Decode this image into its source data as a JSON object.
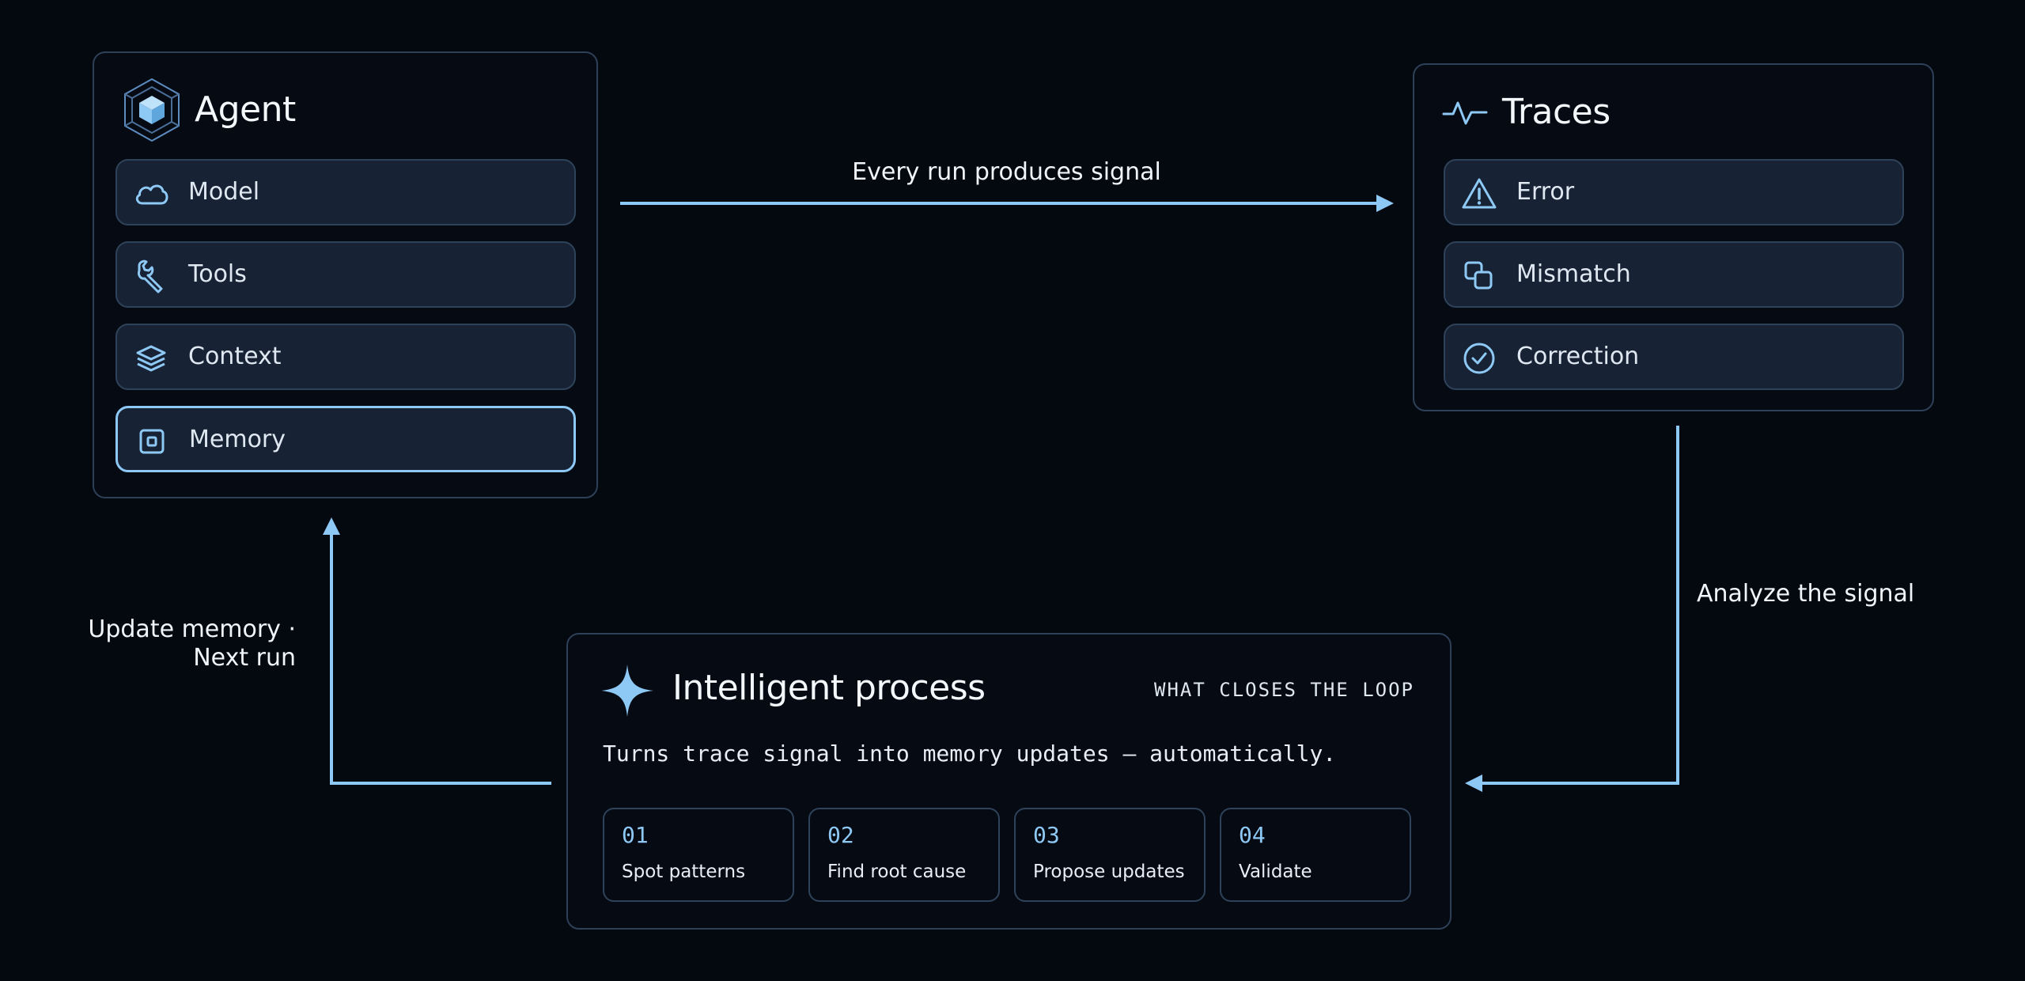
{
  "colors": {
    "background": "#04080f",
    "card_border": "#2d4058",
    "row_fill": "#172234",
    "accent": "#8ec9f5"
  },
  "agent": {
    "title": "Agent",
    "icon": "cube-icon",
    "items": [
      {
        "label": "Model",
        "icon": "cloud-icon"
      },
      {
        "label": "Tools",
        "icon": "wrench-icon"
      },
      {
        "label": "Context",
        "icon": "layers-icon"
      },
      {
        "label": "Memory",
        "icon": "chip-icon",
        "selected": true
      }
    ]
  },
  "traces": {
    "title": "Traces",
    "icon": "pulse-icon",
    "items": [
      {
        "label": "Error",
        "icon": "warning-icon"
      },
      {
        "label": "Mismatch",
        "icon": "copy-icon"
      },
      {
        "label": "Correction",
        "icon": "check-circle-icon"
      }
    ]
  },
  "process": {
    "title": "Intelligent process",
    "icon": "sparkle-icon",
    "tag": "WHAT CLOSES THE LOOP",
    "description": "Turns trace signal into memory updates — automatically.",
    "steps": [
      {
        "num": "01",
        "label": "Spot patterns"
      },
      {
        "num": "02",
        "label": "Find root cause"
      },
      {
        "num": "03",
        "label": "Propose updates"
      },
      {
        "num": "04",
        "label": "Validate"
      }
    ]
  },
  "edges": {
    "agent_to_traces": "Every run produces signal",
    "traces_to_process": "Analyze the signal",
    "process_to_agent_line1": "Update memory ·",
    "process_to_agent_line2": "Next run"
  }
}
